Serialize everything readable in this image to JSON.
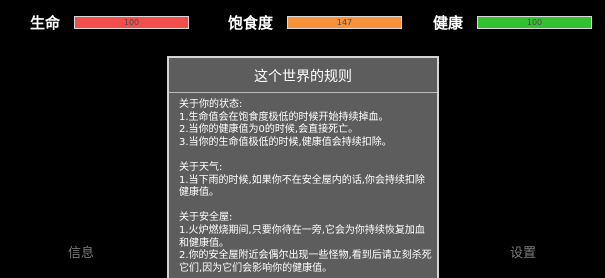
{
  "hud": {
    "stats": [
      {
        "label": "生命",
        "value": "100",
        "fill_percent": 100,
        "color": "#f24e4e"
      },
      {
        "label": "饱食度",
        "value": "147",
        "fill_percent": 100,
        "color": "#f5923b"
      },
      {
        "label": "健康",
        "value": "100",
        "fill_percent": 100,
        "color": "#33c033"
      }
    ]
  },
  "buttons": {
    "info": "信息",
    "settings": "设置"
  },
  "dialog": {
    "title": "这个世界的规则",
    "sections": [
      {
        "heading": "关于你的状态:",
        "lines": [
          "1.生命值会在饱食度极低的时候开始持续掉血。",
          "2.当你的健康值为0的时候,会直接死亡。",
          "3.当你的生命值极低的时候,健康值会持续扣除。"
        ]
      },
      {
        "heading": "关于天气:",
        "lines": [
          "1.当下雨的时候,如果你不在安全屋内的话,你会持续扣除",
          "健康值。"
        ]
      },
      {
        "heading": "关于安全屋:",
        "lines": [
          "1.火炉燃烧期间,只要你待在一旁,它会为你持续恢复加血",
          "和健康值。",
          "2.你的安全屋附近会偶尔出现一些怪物,看到后请立刻杀死",
          "它们,因为它们会影响你的健康值。"
        ]
      }
    ]
  }
}
